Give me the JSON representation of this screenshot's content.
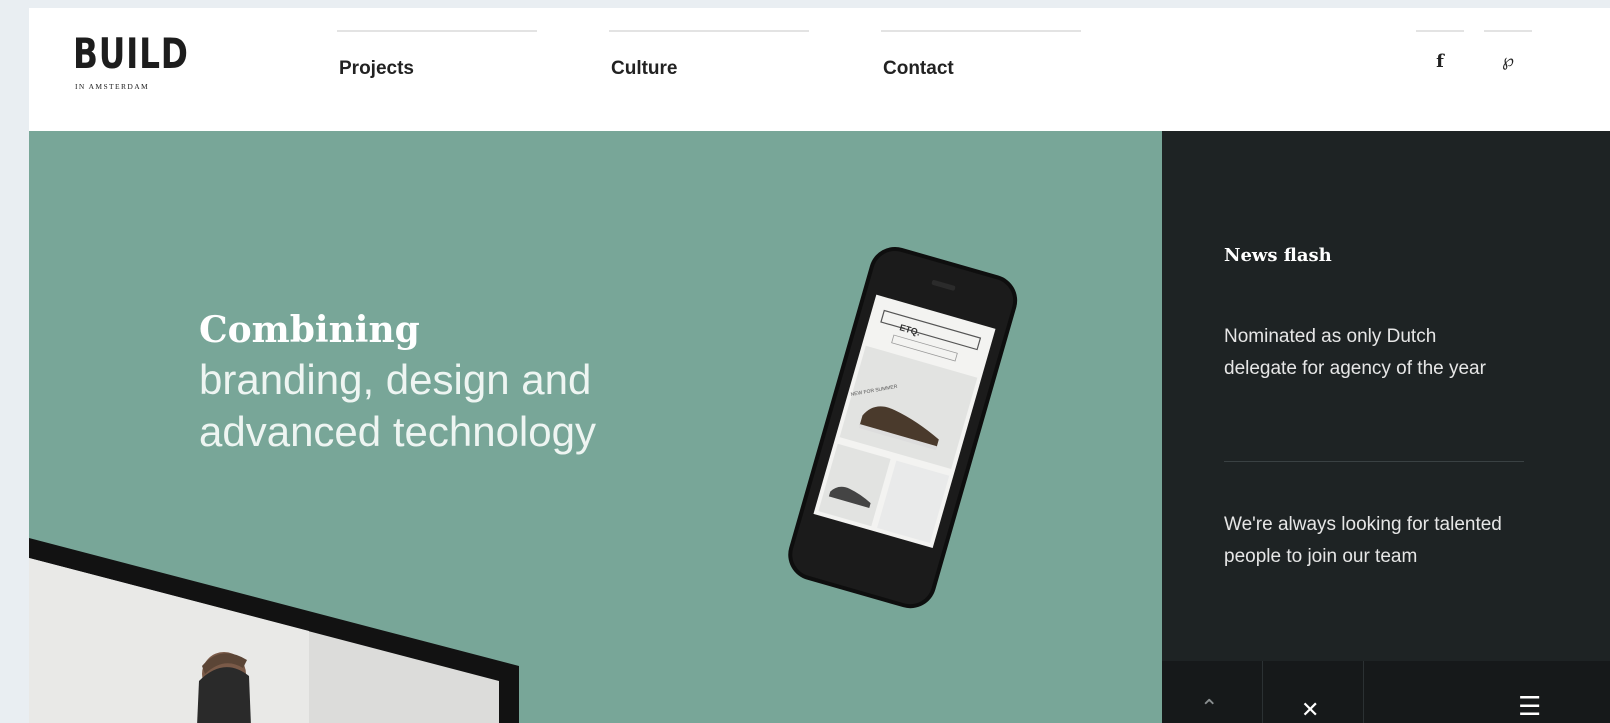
{
  "header": {
    "logo": {
      "main": "BUILD",
      "sub": "IN AMSTERDAM"
    },
    "nav": [
      {
        "label": "Projects"
      },
      {
        "label": "Culture"
      },
      {
        "label": "Contact"
      }
    ],
    "social": [
      {
        "icon": "facebook-icon",
        "glyph": "f"
      },
      {
        "icon": "pinterest-icon",
        "glyph": "℘"
      }
    ]
  },
  "hero": {
    "headline_bold": "Combining",
    "headline_line1": "branding, design and",
    "headline_line2": "advanced technology",
    "phone_screen": {
      "brand": "ETQ.",
      "caption": "NEW FOR SUMMER"
    }
  },
  "sidebar": {
    "title": "News flash",
    "items": [
      {
        "text": "Nominated as only Dutch delegate for agency of the year"
      },
      {
        "text": "We're always looking for talented people to join our team"
      }
    ],
    "bottom": {
      "up_icon": "chevron-up-icon",
      "close_icon": "close-icon",
      "menu_icon": "menu-icon",
      "up_glyph": "⌃",
      "close_glyph": "✕",
      "menu_glyph": "☰"
    }
  },
  "colors": {
    "accent": "#78a698",
    "sidebar": "#1e2324",
    "text": "#222222"
  }
}
